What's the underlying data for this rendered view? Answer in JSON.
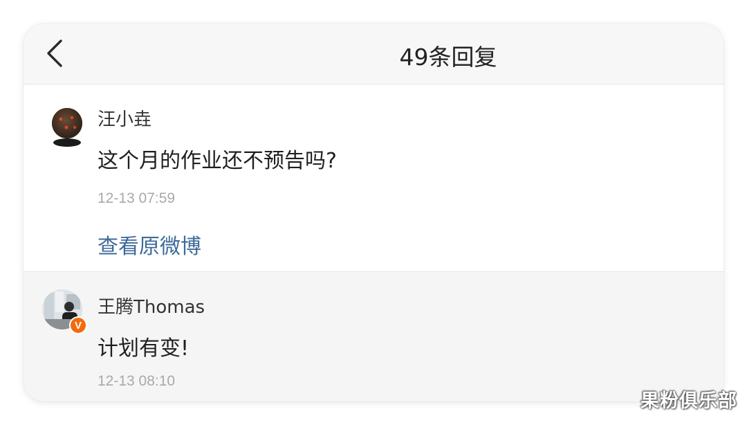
{
  "header": {
    "title": "49条回复",
    "back_icon": "chevron-left-icon"
  },
  "comment": {
    "username": "汪小垚",
    "text": "这个月的作业还不预告吗?",
    "time": "12-13 07:59",
    "link_label": "查看原微博"
  },
  "reply": {
    "username": "王腾Thomas",
    "text": "计划有变!",
    "time": "12-13 08:10",
    "verified_badge": "V",
    "badge_color": "#f26b0f"
  },
  "watermark": "果粉俱乐部",
  "colors": {
    "link": "#3d6a99",
    "time": "#a9a9a9"
  }
}
